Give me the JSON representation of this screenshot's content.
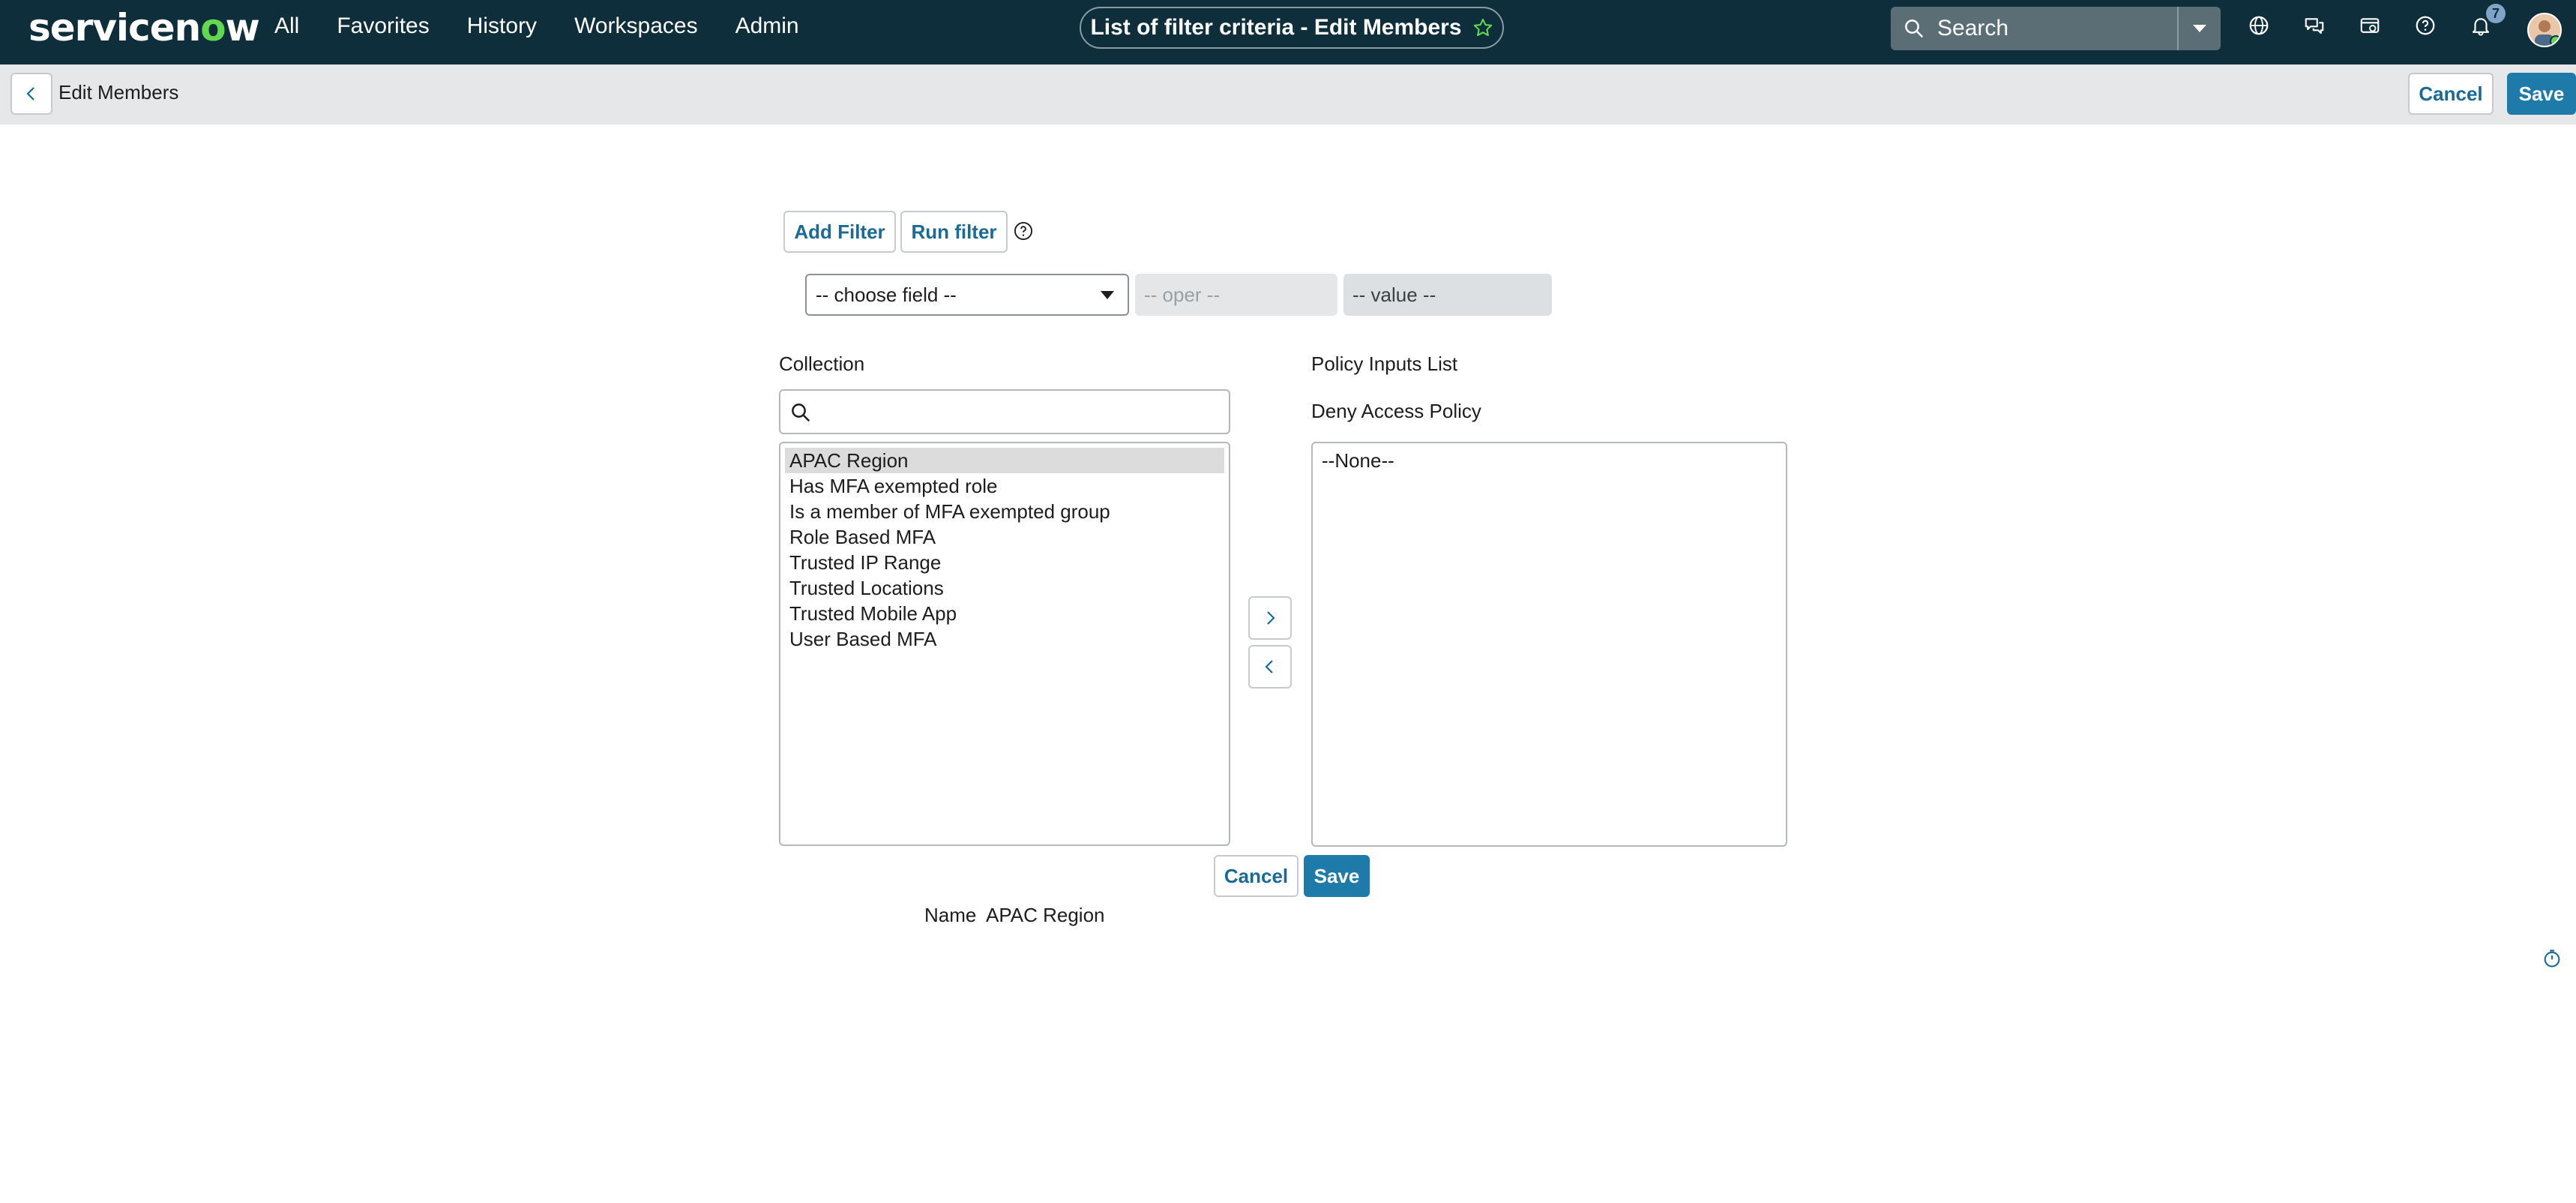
{
  "topnav": {
    "logo": "servicenow",
    "menu": [
      "All",
      "Favorites",
      "History",
      "Workspaces",
      "Admin"
    ],
    "title": "List of filter criteria - Edit Members",
    "search_placeholder": "Search",
    "notification_count": "7",
    "icons": [
      "globe-icon",
      "chat-icon",
      "card-icon",
      "help-icon",
      "bell-icon"
    ]
  },
  "subbar": {
    "title": "Edit Members",
    "cancel_label": "Cancel",
    "save_label": "Save"
  },
  "filter": {
    "add_filter_label": "Add Filter",
    "run_filter_label": "Run filter",
    "field_placeholder": "-- choose field --",
    "oper_placeholder": "-- oper --",
    "value_placeholder": "-- value --"
  },
  "collection": {
    "label": "Collection",
    "items": [
      "APAC Region",
      "Has MFA exempted role",
      "Is a member of MFA exempted group",
      "Role Based MFA",
      "Trusted IP Range",
      "Trusted Locations",
      "Trusted Mobile App",
      "User Based MFA"
    ],
    "selected": "APAC Region"
  },
  "policy": {
    "label": "Policy Inputs List",
    "sublabel": "Deny Access Policy",
    "items": [
      "--None--"
    ]
  },
  "form": {
    "cancel_label": "Cancel",
    "save_label": "Save",
    "name_label": "Name",
    "name_value": "APAC Region"
  },
  "colors": {
    "nav_bg": "#0f2e3b",
    "accent": "#1e7aa8",
    "brand_green": "#62d84e"
  }
}
